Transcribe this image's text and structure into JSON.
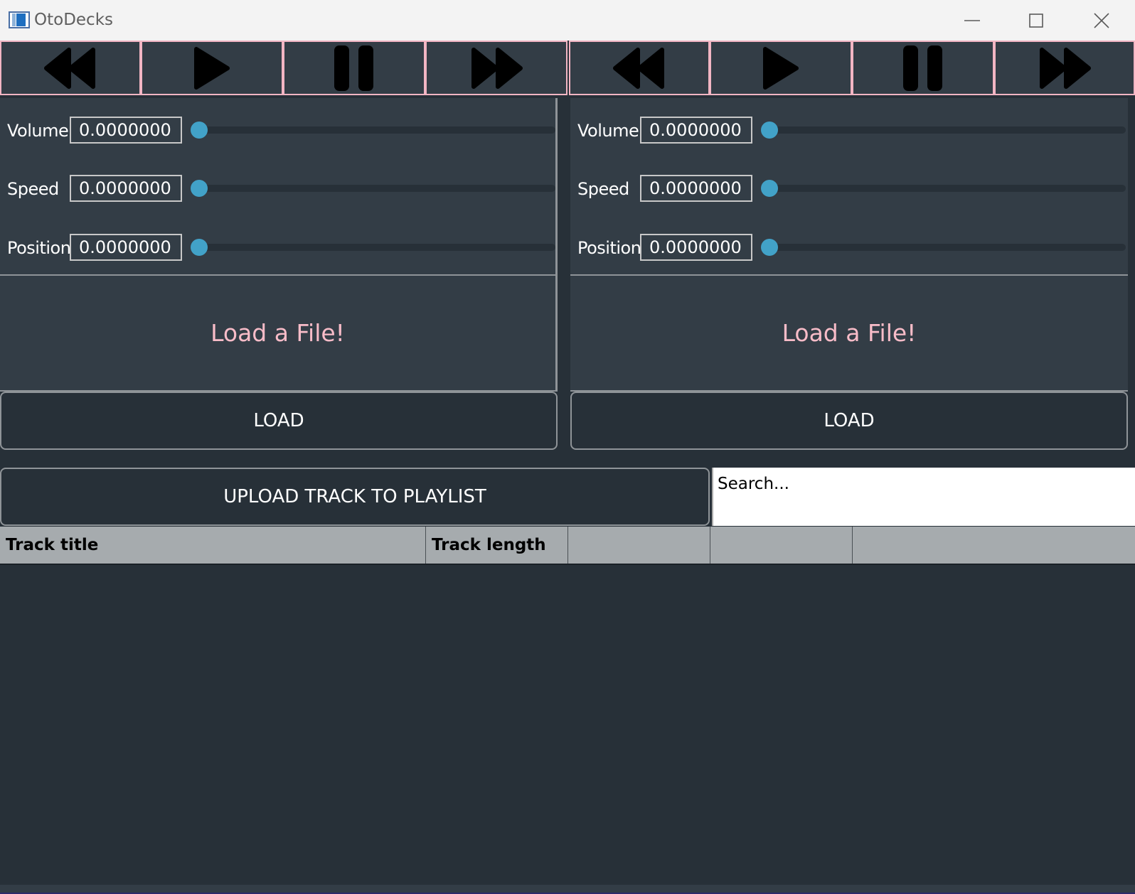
{
  "window": {
    "title": "OtoDecks",
    "controls": [
      "minimize-icon",
      "maximize-icon",
      "close-icon"
    ]
  },
  "decks": [
    {
      "transport": [
        "rewind-icon",
        "play-icon",
        "pause-icon",
        "fast-forward-icon"
      ],
      "sliders": [
        {
          "label": "Volume",
          "value": "0.0000000",
          "level": 0
        },
        {
          "label": "Speed",
          "value": "0.0000000",
          "level": 0
        },
        {
          "label": "Position",
          "value": "0.0000000",
          "level": 0
        }
      ],
      "waveform_text": "Load a File!",
      "load_label": "LOAD"
    },
    {
      "transport": [
        "rewind-icon",
        "play-icon",
        "pause-icon",
        "fast-forward-icon"
      ],
      "sliders": [
        {
          "label": "Volume",
          "value": "0.0000000",
          "level": 0
        },
        {
          "label": "Speed",
          "value": "0.0000000",
          "level": 0
        },
        {
          "label": "Position",
          "value": "0.0000000",
          "level": 0
        }
      ],
      "waveform_text": "Load a File!",
      "load_label": "LOAD"
    }
  ],
  "playlist": {
    "upload_label": "UPLOAD TRACK TO PLAYLIST",
    "search_placeholder": "Search...",
    "columns": [
      "Track title",
      "Track length",
      "",
      "",
      ""
    ],
    "rows": []
  },
  "colors": {
    "accent_pink": "#f2b5c3",
    "slider_thumb": "#42a2c8",
    "panel": "#333d46",
    "background": "#273038"
  }
}
